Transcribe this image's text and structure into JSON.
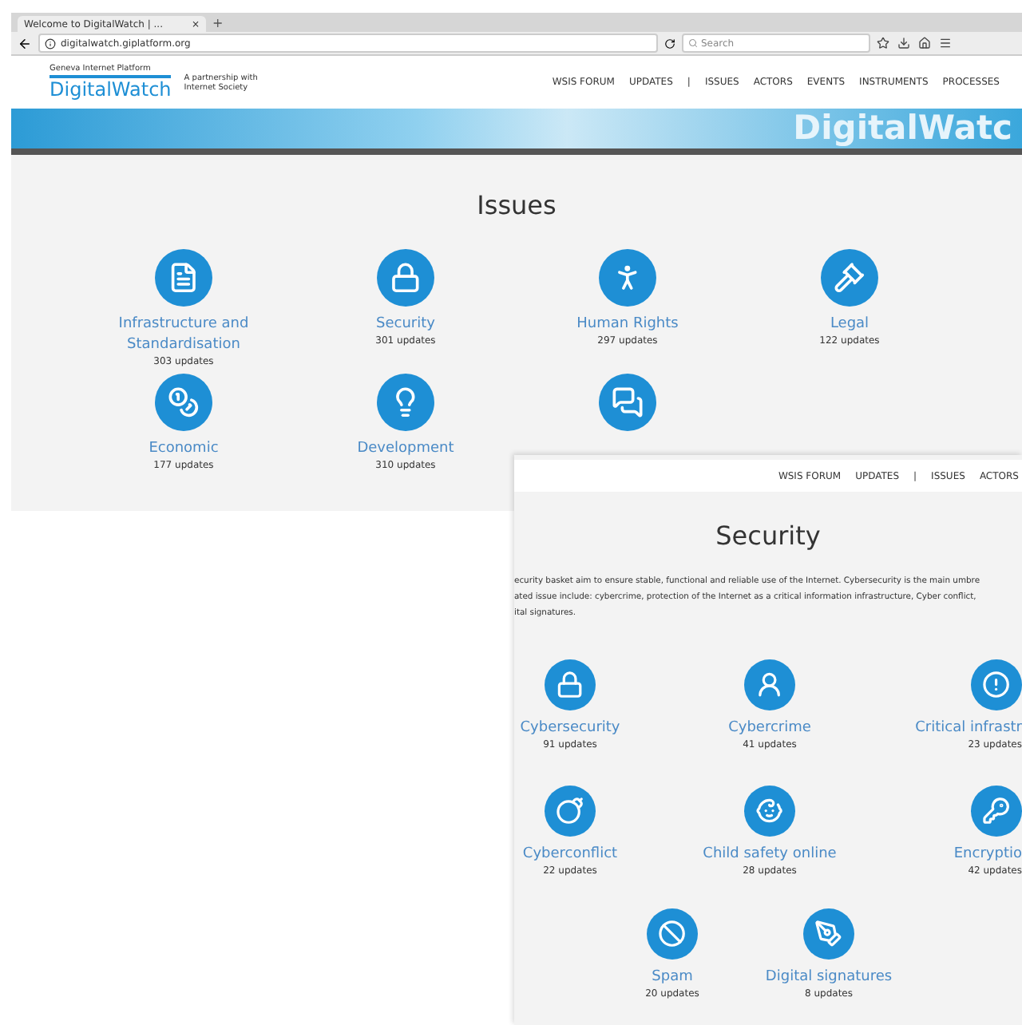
{
  "browser": {
    "tab_title": "Welcome to DigitalWatch | ...",
    "tab_close": "×",
    "new_tab": "+",
    "url": "digitalwatch.giplatform.org",
    "search": {
      "placeholder": "Search"
    }
  },
  "site_header": {
    "logo_top": "Geneva Internet Platform",
    "logo": "DigitalWatch",
    "partner_line1": "A partnership with",
    "partner_line2": "Internet Society",
    "nav": [
      "WSIS FORUM",
      "UPDATES",
      "|",
      "ISSUES",
      "ACTORS",
      "EVENTS",
      "INSTRUMENTS",
      "PROCESSES"
    ],
    "banner_text": "DigitalWatc"
  },
  "issues_page": {
    "title": "Issues",
    "items": [
      {
        "label": "Infrastructure and Standardisation",
        "count": "303 updates"
      },
      {
        "label": "Security",
        "count": "301 updates"
      },
      {
        "label": "Human Rights",
        "count": "297 updates"
      },
      {
        "label": "Legal",
        "count": "122 updates"
      },
      {
        "label": "Economic",
        "count": "177 updates"
      },
      {
        "label": "Development",
        "count": "310 updates"
      }
    ]
  },
  "security_page": {
    "nav": [
      "WSIS FORUM",
      "UPDATES",
      "|",
      "ISSUES",
      "ACTORS"
    ],
    "title": "Security",
    "intro_lines": [
      "ecurity basket aim to ensure stable, functional and reliable use of the Internet. Cybersecurity is the main umbre",
      "ated issue include: cybercrime, protection of the Internet as a critical information infrastructure, Cyber conflict,",
      "ital signatures."
    ],
    "items": [
      {
        "label": "Cybersecurity",
        "count": "91 updates"
      },
      {
        "label": "Cybercrime",
        "count": "41 updates"
      },
      {
        "label": "Critical infrastr",
        "count": "23 updates"
      },
      {
        "label": "Cyberconflict",
        "count": "22 updates"
      },
      {
        "label": "Child safety online",
        "count": "28 updates"
      },
      {
        "label": "Encryptio",
        "count": "42 updates"
      }
    ],
    "bottom_items": [
      {
        "label": "Spam",
        "count": "20 updates"
      },
      {
        "label": "Digital signatures",
        "count": "8 updates"
      }
    ]
  }
}
